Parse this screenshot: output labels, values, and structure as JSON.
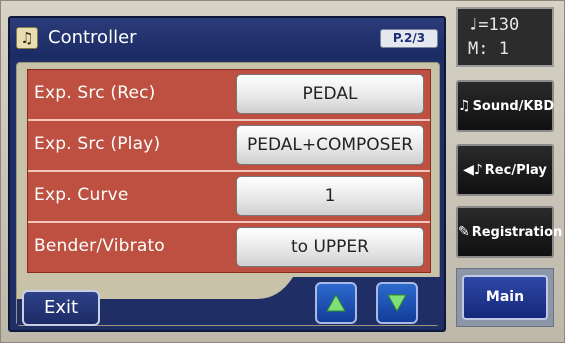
{
  "window": {
    "title": "Controller",
    "page_indicator": "P.2/3",
    "icon": "music-note-icon"
  },
  "rows": [
    {
      "label": "Exp. Src (Rec)",
      "value": "PEDAL"
    },
    {
      "label": "Exp. Src (Play)",
      "value": "PEDAL+COMPOSER"
    },
    {
      "label": "Exp. Curve",
      "value": "1"
    },
    {
      "label": "Bender/Vibrato",
      "value": "to UPPER"
    }
  ],
  "footer": {
    "exit_label": "Exit",
    "up_icon": "arrow-up-icon",
    "down_icon": "arrow-down-icon"
  },
  "tempo": {
    "line1": "♩=130",
    "line2": "M:  1"
  },
  "side_buttons": {
    "sound_kbd": "Sound/KBD",
    "rec_play": "Rec/Play",
    "registration": "Registration",
    "main": "Main"
  },
  "colors": {
    "row_label_bg": "#bd5040",
    "panel_navy": "#1f2f66",
    "arrow_button": "#1f5bbf"
  }
}
